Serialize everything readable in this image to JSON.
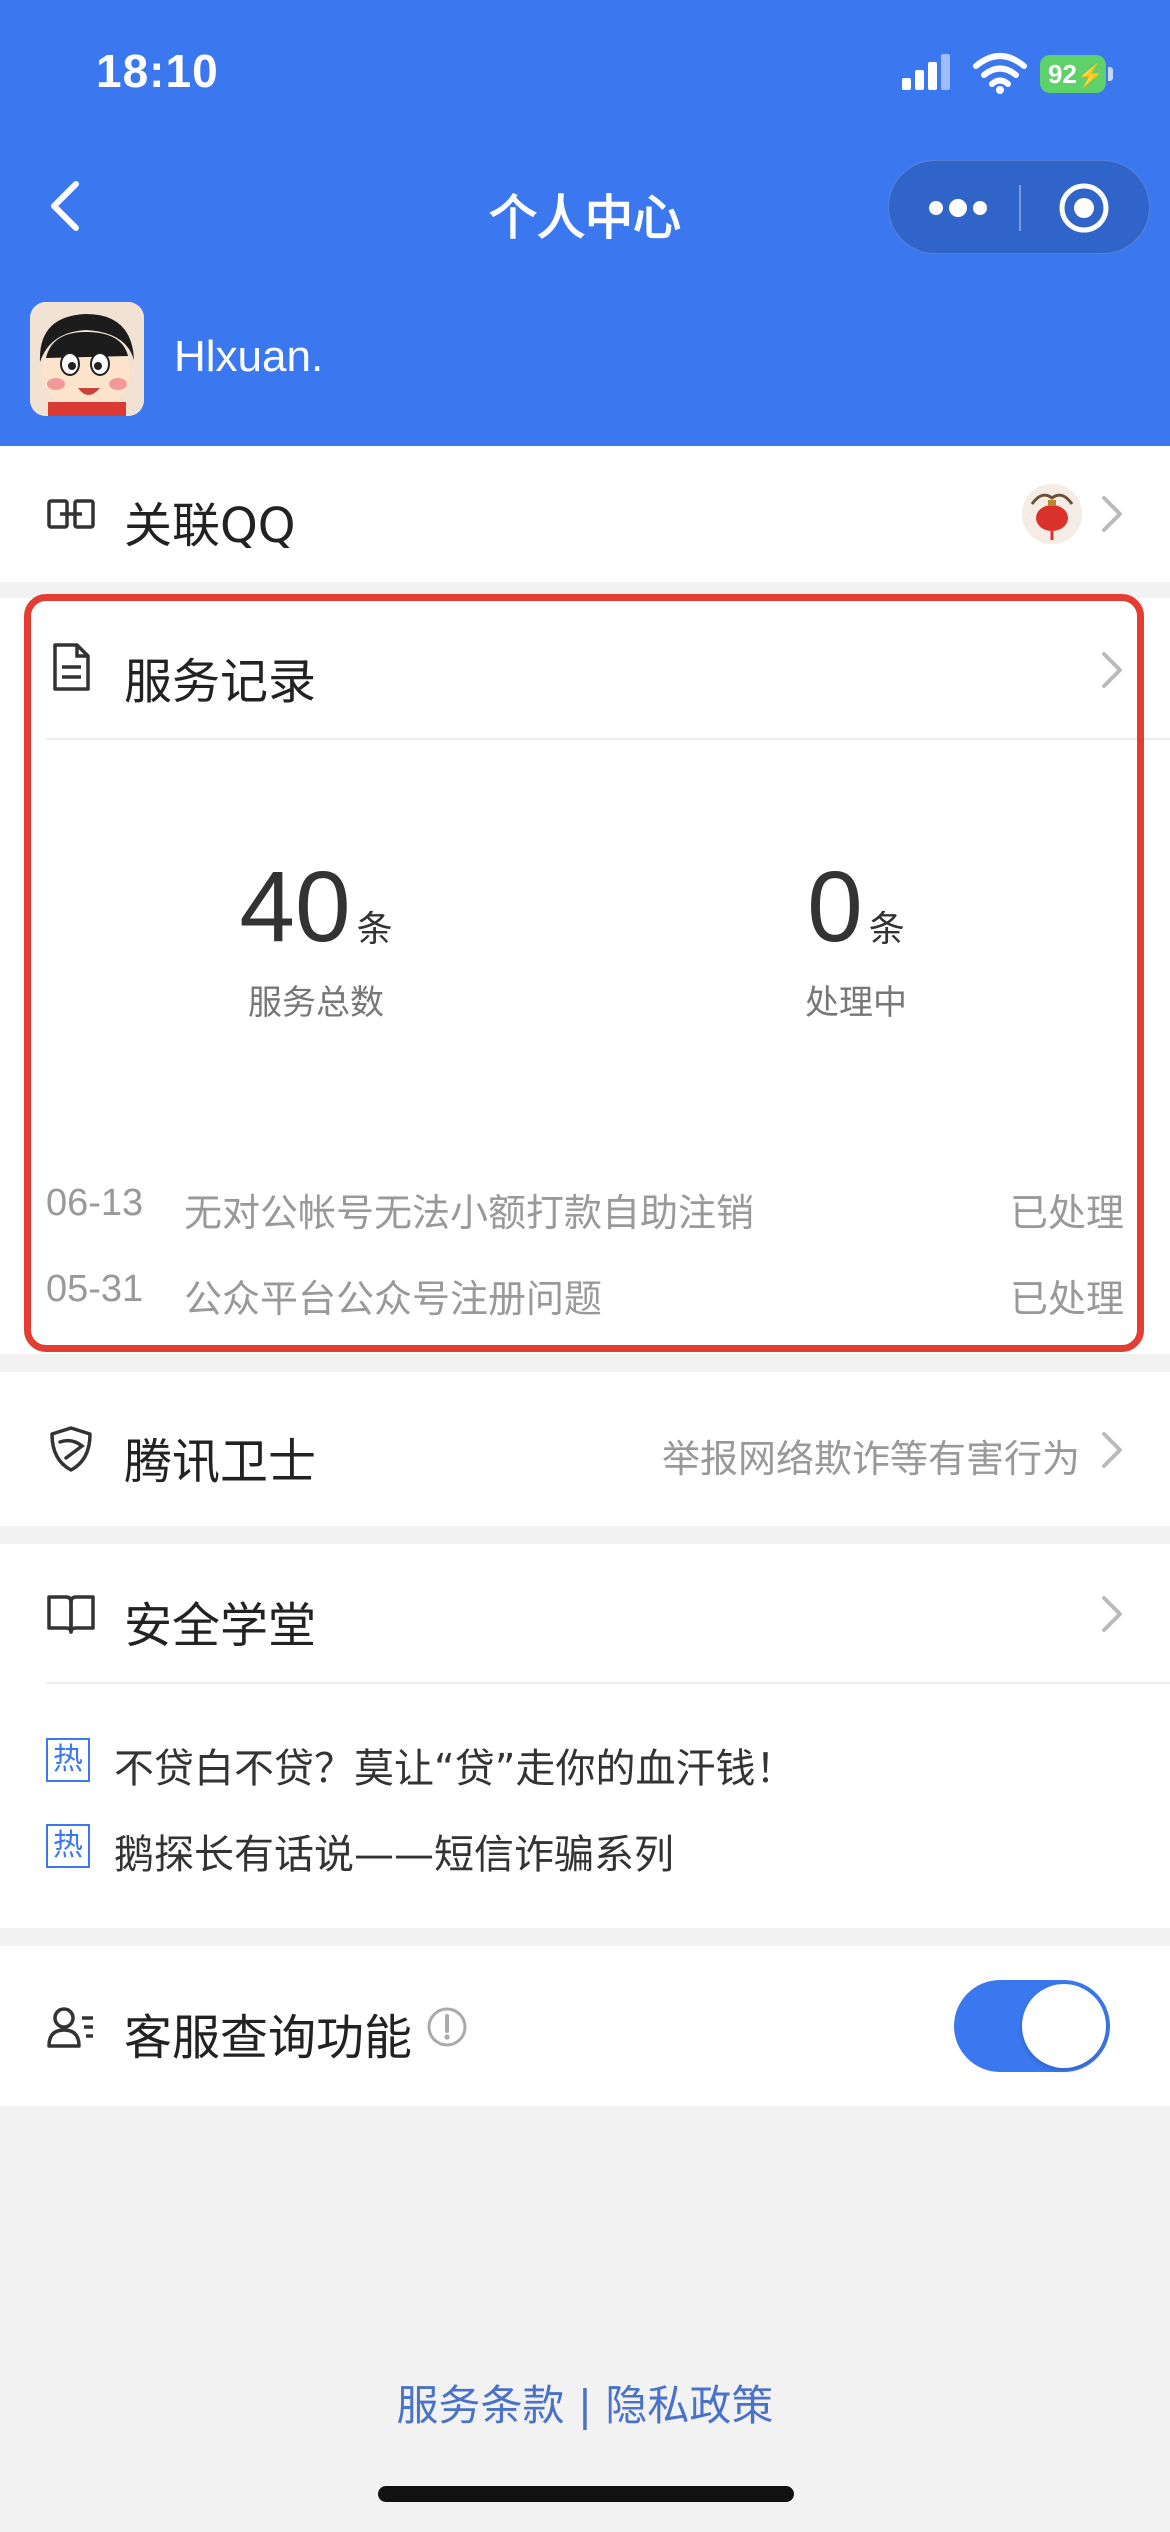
{
  "status_bar": {
    "time": "18:10",
    "battery": "92"
  },
  "nav": {
    "title": "个人中心"
  },
  "profile": {
    "username": "Hlxuan."
  },
  "linked_qq": {
    "label": "关联QQ"
  },
  "service_records": {
    "title": "服务记录",
    "total": {
      "value": "40",
      "unit": "条",
      "label": "服务总数"
    },
    "processing": {
      "value": "0",
      "unit": "条",
      "label": "处理中"
    },
    "records": [
      {
        "date": "06-13",
        "title": "无对公帐号无法小额打款自助注销",
        "status": "已处理"
      },
      {
        "date": "05-31",
        "title": "公众平台公众号注册问题",
        "status": "已处理"
      }
    ],
    "highlight_color": "#e43d32"
  },
  "tencent_guard": {
    "label": "腾讯卫士",
    "hint": "举报网络欺诈等有害行为"
  },
  "security_school": {
    "label": "安全学堂",
    "hot_tag": "热",
    "articles": [
      "不贷白不贷？莫让“贷”走你的血汗钱！",
      "鹅探长有话说——短信诈骗系列"
    ]
  },
  "customer_service": {
    "label": "客服查询功能",
    "toggle_on": true
  },
  "footer": {
    "terms": "服务条款",
    "separator": " | ",
    "privacy": "隐私政策"
  },
  "colors": {
    "header_bg": "#3b78f0",
    "accent": "#3b78f0",
    "link": "#4a72c8"
  }
}
